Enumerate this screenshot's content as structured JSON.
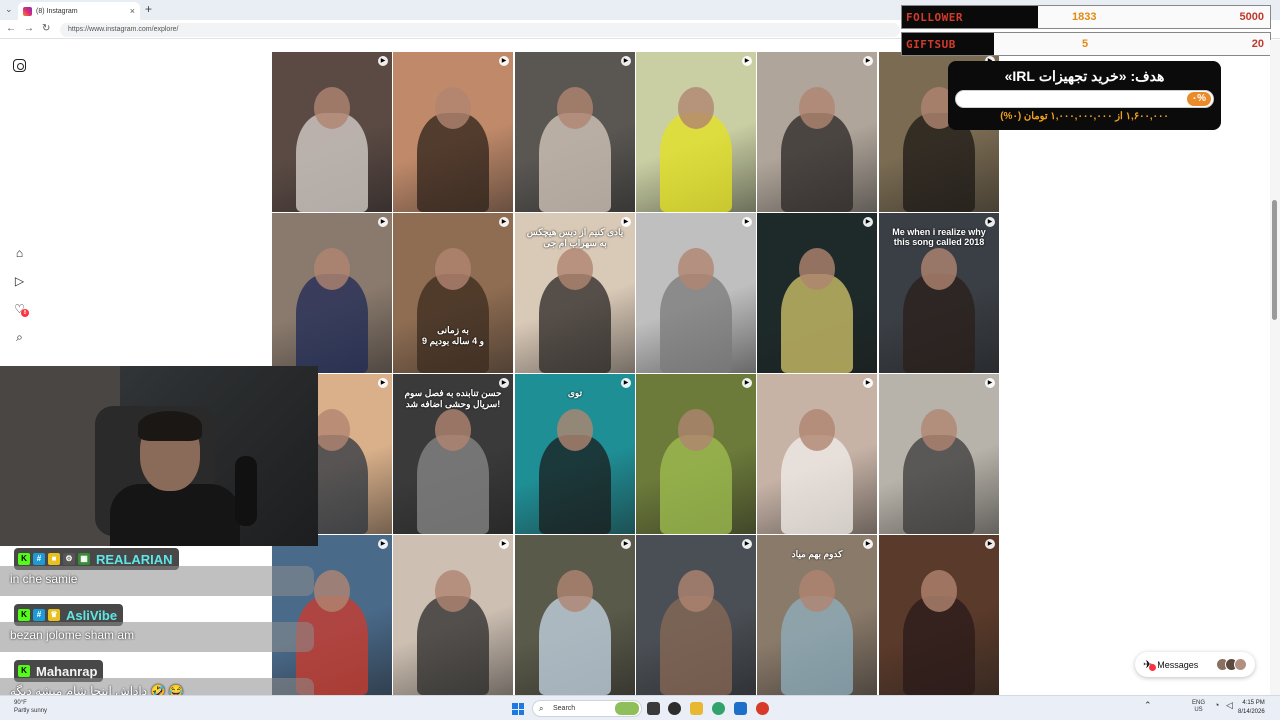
{
  "browser": {
    "tab_title": "(8) Instagram",
    "url": "https://www.instagram.com/explore/",
    "new_tab": "+",
    "close": "×"
  },
  "nav": {
    "icons": [
      "home-icon",
      "reels-icon",
      "activity-icon",
      "search-icon"
    ],
    "notification_count": "8"
  },
  "grid": {
    "tiles": [
      {
        "color": "#5b4a44",
        "accent": "#d9d4cf",
        "caption": ""
      },
      {
        "color": "#c08a6a",
        "accent": "#2d211a",
        "caption": ""
      },
      {
        "color": "#5a5753",
        "accent": "#d8cbbf",
        "caption": ""
      },
      {
        "color": "#c9cfa3",
        "accent": "#e4e21e",
        "caption": ""
      },
      {
        "color": "#b0a59a",
        "accent": "#2a2624",
        "caption": ""
      },
      {
        "color": "#7a6b52",
        "accent": "#1c1815",
        "caption": ""
      },
      {
        "color": "#8a7a6d",
        "accent": "#1d2a55",
        "caption": ""
      },
      {
        "color": "#8f6d52",
        "accent": "#3b2b1f",
        "caption": "به زمانی\n9 و 4 ساله بودیم"
      },
      {
        "color": "#d9c9b7",
        "accent": "#2a2624",
        "caption": "یادی کنیم از دیس هیچکس\nبه سهراب ام جی"
      },
      {
        "color": "#bfbfbf",
        "accent": "#7a7a7a",
        "caption": ""
      },
      {
        "color": "#1e2a2a",
        "accent": "#d6c86b",
        "caption": ""
      },
      {
        "color": "#3a3f45",
        "accent": "#2a1f1a",
        "caption": "Me when i realize why this song called 2018"
      },
      {
        "color": "#d9b08a",
        "accent": "#2c3540",
        "caption": ""
      },
      {
        "color": "#3a3a3a",
        "accent": "#8a8a8a",
        "caption": "حسن تنابنده به فصل سوم\nسریال وحشی اضافه شد!"
      },
      {
        "color": "#1f8f96",
        "accent": "#1b1b1b",
        "caption": "توی"
      },
      {
        "color": "#6c7a3a",
        "accent": "#a0c050",
        "caption": ""
      },
      {
        "color": "#c7b3a6",
        "accent": "#f2eeea",
        "caption": ""
      },
      {
        "color": "#b8b3aa",
        "accent": "#3a3a3a",
        "caption": ""
      },
      {
        "color": "#4a6a8a",
        "accent": "#d23a2a",
        "caption": ""
      },
      {
        "color": "#cdbfb2",
        "accent": "#2a2a2a",
        "caption": ""
      },
      {
        "color": "#5a5a4a",
        "accent": "#c8d8e8",
        "caption": ""
      },
      {
        "color": "#4a4f55",
        "accent": "#8a6a55",
        "caption": ""
      },
      {
        "color": "#8a7a6a",
        "accent": "#8fb0c0",
        "caption": "کدوم بهم میاد"
      },
      {
        "color": "#5a3a2a",
        "accent": "#2a1a1a",
        "caption": ""
      }
    ]
  },
  "overlay": {
    "follower": {
      "label": "FOLLOWER",
      "current": "1833",
      "goal": "5000",
      "progress": 0.3666
    },
    "giftsub": {
      "label": "GIFTSUB",
      "current": "5",
      "goal": "20",
      "progress": 0.25
    },
    "goal_box": {
      "title": "هدف: «خرید تجهیزات IRL»",
      "percent": "۰%",
      "amount": "۱,۶۰۰,۰۰۰ از ۱,۰۰۰,۰۰۰,۰۰۰ تومان (۰%)",
      "progress": 0.0
    }
  },
  "chat": [
    {
      "user": "REALARIAN",
      "color": "#5fe6e6",
      "badges": [
        "K",
        "#",
        "■",
        "⚙",
        "▦"
      ],
      "message": "in che samie"
    },
    {
      "user": "AsliVibe",
      "color": "#5fe6e6",
      "badges": [
        "K",
        "#",
        "♛"
      ],
      "message": "bezan jolome sham am"
    },
    {
      "user": "Mahanrap",
      "color": "#f4f4f4",
      "badges": [
        "K"
      ],
      "message": "داداش اینجا شام میشه دیگه 🤣 😂"
    }
  ],
  "messages": {
    "label": "Messages"
  },
  "taskbar": {
    "weather_temp": "90°F",
    "weather_desc": "Partly sunny",
    "search_placeholder": "Search",
    "lang1": "ENG",
    "lang2": "US",
    "time": "4:15 PM",
    "date": "8/14/2026"
  }
}
